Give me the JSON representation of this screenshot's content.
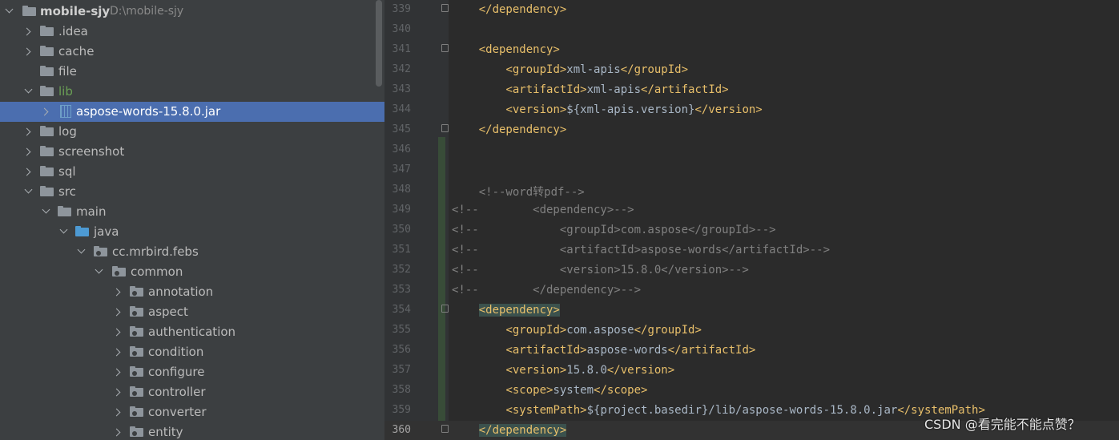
{
  "tree": {
    "root": {
      "name": "mobile-sjy",
      "path": "D:\\mobile-sjy"
    },
    "items": [
      {
        "label": ".idea"
      },
      {
        "label": "cache"
      },
      {
        "label": "file"
      },
      {
        "label": "lib"
      },
      {
        "label": "aspose-words-15.8.0.jar"
      },
      {
        "label": "log"
      },
      {
        "label": "screenshot"
      },
      {
        "label": "sql"
      },
      {
        "label": "src"
      },
      {
        "label": "main"
      },
      {
        "label": "java"
      },
      {
        "label": "cc.mrbird.febs"
      },
      {
        "label": "common"
      },
      {
        "label": "annotation"
      },
      {
        "label": "aspect"
      },
      {
        "label": "authentication"
      },
      {
        "label": "condition"
      },
      {
        "label": "configure"
      },
      {
        "label": "controller"
      },
      {
        "label": "converter"
      },
      {
        "label": "entity"
      }
    ]
  },
  "editor": {
    "current_line": "360",
    "lines": [
      {
        "n": "339",
        "code": [
          {
            "s": "    "
          },
          {
            "t": "</dependency>"
          }
        ]
      },
      {
        "n": "340",
        "code": []
      },
      {
        "n": "341",
        "code": [
          {
            "s": "    "
          },
          {
            "t": "<dependency>"
          }
        ]
      },
      {
        "n": "342",
        "code": [
          {
            "s": "        "
          },
          {
            "t": "<groupId>"
          },
          {
            "v": "xml-apis"
          },
          {
            "t": "</groupId>"
          }
        ]
      },
      {
        "n": "343",
        "code": [
          {
            "s": "        "
          },
          {
            "t": "<artifactId>"
          },
          {
            "v": "xml-apis"
          },
          {
            "t": "</artifactId>"
          }
        ]
      },
      {
        "n": "344",
        "code": [
          {
            "s": "        "
          },
          {
            "t": "<version>"
          },
          {
            "v": "${xml-apis.version}"
          },
          {
            "t": "</version>"
          }
        ]
      },
      {
        "n": "345",
        "code": [
          {
            "s": "    "
          },
          {
            "t": "</dependency>"
          }
        ]
      },
      {
        "n": "346",
        "code": []
      },
      {
        "n": "347",
        "code": []
      },
      {
        "n": "348",
        "code": [
          {
            "s": "    "
          },
          {
            "c": "<!--word转pdf-->"
          }
        ]
      },
      {
        "n": "349",
        "code": [
          {
            "c": "<!--        <dependency>-->"
          }
        ]
      },
      {
        "n": "350",
        "code": [
          {
            "c": "<!--            <groupId>com.aspose</groupId>-->"
          }
        ]
      },
      {
        "n": "351",
        "code": [
          {
            "c": "<!--            <artifactId>aspose-words</artifactId>-->"
          }
        ]
      },
      {
        "n": "352",
        "code": [
          {
            "c": "<!--            <version>15.8.0</version>-->"
          }
        ]
      },
      {
        "n": "353",
        "code": [
          {
            "c": "<!--        </dependency>-->"
          }
        ]
      },
      {
        "n": "354",
        "code": [
          {
            "s": "    "
          },
          {
            "h": "<dependency>"
          }
        ]
      },
      {
        "n": "355",
        "code": [
          {
            "s": "        "
          },
          {
            "t": "<groupId>"
          },
          {
            "v": "com.aspose"
          },
          {
            "t": "</groupId>"
          }
        ]
      },
      {
        "n": "356",
        "code": [
          {
            "s": "        "
          },
          {
            "t": "<artifactId>"
          },
          {
            "v": "aspose-words"
          },
          {
            "t": "</artifactId>"
          }
        ]
      },
      {
        "n": "357",
        "code": [
          {
            "s": "        "
          },
          {
            "t": "<version>"
          },
          {
            "v": "15.8.0"
          },
          {
            "t": "</version>"
          }
        ]
      },
      {
        "n": "358",
        "code": [
          {
            "s": "        "
          },
          {
            "t": "<scope>"
          },
          {
            "v": "system"
          },
          {
            "t": "</scope>"
          }
        ]
      },
      {
        "n": "359",
        "code": [
          {
            "s": "        "
          },
          {
            "t": "<systemPath>"
          },
          {
            "v": "${project.basedir}/lib/aspose-words-15.8.0.jar"
          },
          {
            "t": "</systemPath>"
          }
        ]
      },
      {
        "n": "360",
        "code": [
          {
            "s": "    "
          },
          {
            "h": "</dependency>"
          }
        ]
      }
    ]
  },
  "watermark": "CSDN @看完能不能点赞？",
  "colors": {
    "selection": "#4b6eaf",
    "tag": "#e8bf6a",
    "comment": "#808080",
    "text": "#a9b7c6",
    "lib_folder": "#6a9f55"
  }
}
